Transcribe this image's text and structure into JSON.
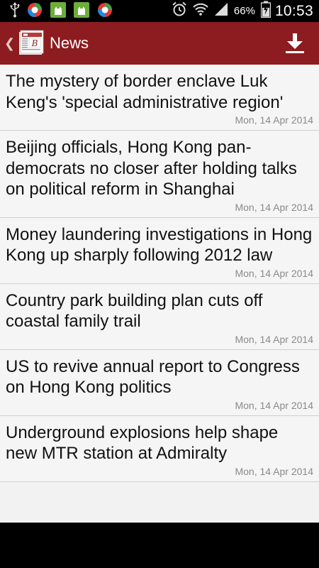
{
  "status_bar": {
    "battery_percent": "66%",
    "time": "10:53",
    "icons": [
      "usb-icon",
      "app-notification-icon",
      "android-update-icon",
      "android-update-icon",
      "app-notification-icon",
      "alarm-icon",
      "wifi-icon",
      "signal-icon",
      "battery-charging-icon"
    ]
  },
  "action_bar": {
    "title": "News",
    "logo_letter": "B",
    "accent": "#8c1c1f"
  },
  "news": [
    {
      "headline": "The mystery of border enclave Luk Keng's 'special administrative region'",
      "date": "Mon, 14 Apr 2014"
    },
    {
      "headline": "Beijing officials, Hong Kong pan-democrats no closer after holding talks on political reform in Shanghai",
      "date": "Mon, 14 Apr 2014"
    },
    {
      "headline": "Money laundering investigations in Hong Kong up sharply following 2012 law",
      "date": "Mon, 14 Apr 2014"
    },
    {
      "headline": "Country park building plan cuts off coastal family trail",
      "date": "Mon, 14 Apr 2014"
    },
    {
      "headline": "US to revive annual report to Congress on Hong Kong politics",
      "date": "Mon, 14 Apr 2014"
    },
    {
      "headline": "Underground explosions help shape new MTR station at Admiralty",
      "date": "Mon, 14 Apr 2014"
    }
  ]
}
